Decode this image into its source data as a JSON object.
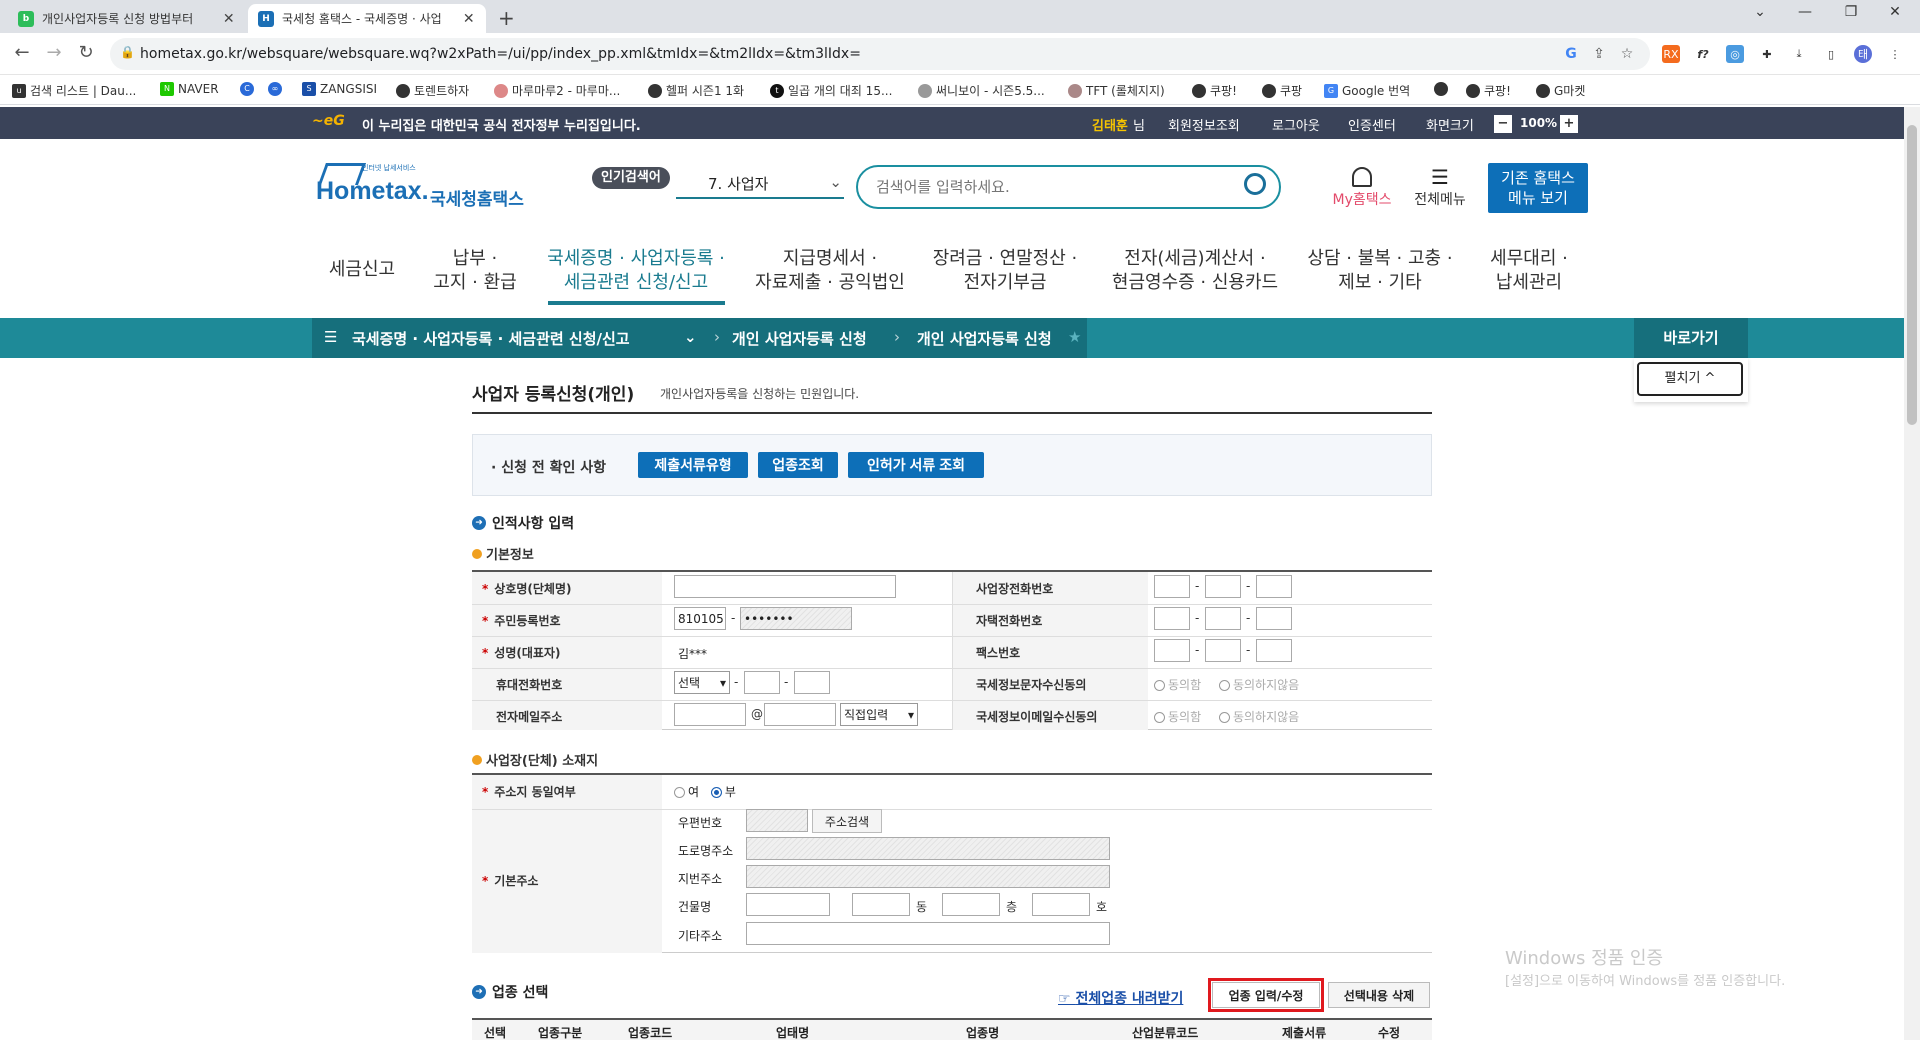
{
  "browser": {
    "tabs": [
      {
        "title": "개인사업자등록 신청 방법부터",
        "favicon": "blog"
      },
      {
        "title": "국세청 홈택스 - 국세증명 · 사업",
        "favicon": "ht"
      }
    ],
    "url": "hometax.go.kr/websquare/websquare.wq?w2xPath=/ui/pp/index_pp.xml&tmIdx=&tm2lIdx=&tm3lIdx=",
    "bookmarks": [
      "검색 리스트 | Dau...",
      "NAVER",
      "ZANGSISI",
      "토렌트하자",
      "마루마루2 - 마루마...",
      "헬퍼 시즌1 1화",
      "일곱 개의 대죄 15...",
      "써니보이 - 시즌5.5...",
      "TFT (롤체지지)",
      "쿠팡!",
      "쿠팡",
      "Google 번역",
      "쿠팡!",
      "G마켓"
    ]
  },
  "gov_banner": {
    "text": "이 누리집은 대한민국 공식 전자정부 누리집입니다.",
    "user": "김태훈",
    "user_suffix": "님",
    "links": [
      "회원정보조회",
      "로그아웃",
      "인증센터",
      "화면크기"
    ],
    "zoom": "100%"
  },
  "header": {
    "logo_small": "인터넷 납세서비스",
    "logo_text": "Hometax.",
    "logo_kr": "국세청홈택스",
    "popular_label": "인기검색어",
    "popular_value": "7.  사업자",
    "search_placeholder": "검색어를 입력하세요.",
    "my_label": "My홈택스",
    "menu_label": "전체메뉴",
    "old_btn_line1": "기존 홈택스",
    "old_btn_line2": "메뉴 보기"
  },
  "gnb": [
    {
      "l1": "세금신고",
      "l2": ""
    },
    {
      "l1": "납부 ·",
      "l2": "고지 · 환급"
    },
    {
      "l1": "국세증명 · 사업자등록 ·",
      "l2": "세금관련 신청/신고"
    },
    {
      "l1": "지급명세서 ·",
      "l2": "자료제출 · 공익법인"
    },
    {
      "l1": "장려금 · 연말정산 ·",
      "l2": "전자기부금"
    },
    {
      "l1": "전자(세금)계산서 ·",
      "l2": "현금영수증 · 신용카드"
    },
    {
      "l1": "상담 · 불복 · 고충 ·",
      "l2": "제보 · 기타"
    },
    {
      "l1": "세무대리 ·",
      "l2": "납세관리"
    }
  ],
  "location": {
    "crumb1": "국세증명 · 사업자등록 · 세금관련 신청/신고",
    "crumb2": "개인 사업자등록 신청",
    "crumb3": "개인 사업자등록 신청",
    "shortcut": "바로가기",
    "expand": "펼치기 ^"
  },
  "page": {
    "title": "사업자 등록신청(개인)",
    "desc": "개인사업자등록을 신청하는 민원입니다.",
    "precheck_label": "· 신청 전 확인 사항",
    "precheck_buttons": [
      "제출서류유형",
      "업종조회",
      "인허가 서류 조회"
    ]
  },
  "personal": {
    "section_title": "인적사항 입력",
    "basic_title": "기본정보",
    "fields": {
      "trade_name": "상호명(단체명)",
      "rrn": "주민등록번호",
      "rrn_front": "810105",
      "rrn_back": "•••••••",
      "name": "성명(대표자)",
      "name_value": "김***",
      "mobile": "휴대전화번호",
      "mobile_select": "선택",
      "email": "전자메일주소",
      "email_at": "@",
      "email_select": "직접입력",
      "biz_phone": "사업장전화번호",
      "home_phone": "자택전화번호",
      "fax": "팩스번호",
      "sms_consent": "국세정보문자수신동의",
      "email_consent": "국세정보이메일수신동의",
      "agree": "동의함",
      "disagree": "동의하지않음"
    }
  },
  "address": {
    "section_title": "사업장(단체) 소재지",
    "same_label": "주소지 동일여부",
    "yes": "여",
    "no": "부",
    "base_label": "기본주소",
    "zip": "우편번호",
    "search_btn": "주소검색",
    "road": "도로명주소",
    "jibun": "지번주소",
    "building": "건물명",
    "dong": "동",
    "floor": "층",
    "ho": "호",
    "etc": "기타주소"
  },
  "industry": {
    "section_title": "업종 선택",
    "download": "전체업종 내려받기",
    "edit_btn": "업종 입력/수정",
    "delete_btn": "선택내용 삭제",
    "columns": [
      "선택",
      "업종구분",
      "업종코드",
      "업태명",
      "업종명",
      "산업분류코드",
      "제출서류",
      "수정"
    ]
  },
  "watermark": {
    "line1": "Windows 정품 인증",
    "line2": "[설정]으로 이동하여 Windows를 정품 인증합니다."
  },
  "colors": {
    "teal": "#1e8a98",
    "blue_btn": "#0d6fb8",
    "highlight": "#e0191e"
  }
}
